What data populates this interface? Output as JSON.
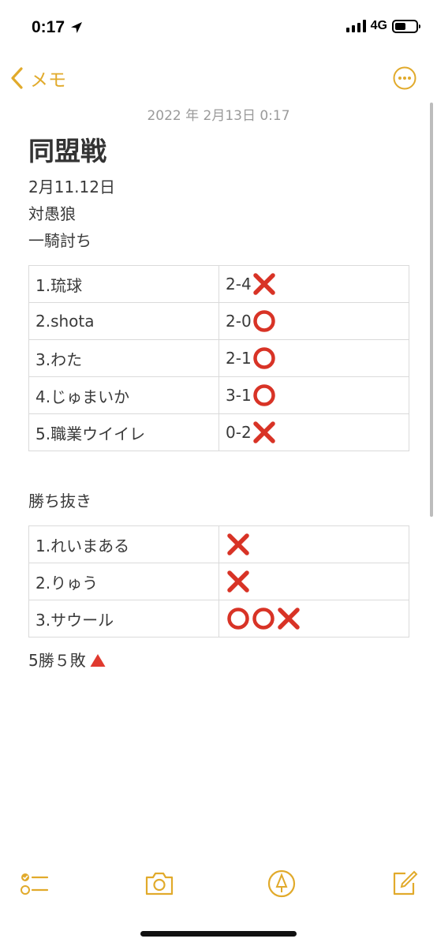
{
  "status_bar": {
    "time": "0:17",
    "network": "4G",
    "battery_level": 0.5,
    "icons": [
      "location-arrow-icon",
      "signal-icon",
      "battery-icon"
    ]
  },
  "nav": {
    "back_label": "メモ",
    "more_icon": "ellipsis-circle-icon",
    "accent_color": "#e1aa2b"
  },
  "note": {
    "date": "2022 年 2月13日 0:17",
    "title": "同盟戦",
    "lines": [
      "2月11.12日",
      "対愚狼",
      "一騎討ち"
    ],
    "table1": [
      {
        "player": "1.琉球",
        "score": "2-4",
        "marks": [
          "cross"
        ]
      },
      {
        "player": "2.shota",
        "score": "2-0",
        "marks": [
          "circle"
        ]
      },
      {
        "player": "3.わた",
        "score": "2-1",
        "marks": [
          "circle"
        ]
      },
      {
        "player": "4.じゅまいか",
        "score": "3-1",
        "marks": [
          "circle"
        ]
      },
      {
        "player": "5.職業ウイイレ",
        "score": "0-2",
        "marks": [
          "cross"
        ]
      }
    ],
    "section2_heading": "勝ち抜き",
    "table2": [
      {
        "player": "1.れいまある",
        "score": "",
        "marks": [
          "cross"
        ]
      },
      {
        "player": "2.りゅう",
        "score": "",
        "marks": [
          "cross"
        ]
      },
      {
        "player": "3.サウール",
        "score": "",
        "marks": [
          "circle",
          "circle",
          "cross"
        ]
      }
    ],
    "summary": "5勝５敗",
    "summary_mark": "triangle"
  },
  "toolbar": {
    "icons": [
      "checklist-icon",
      "camera-icon",
      "markup-icon",
      "compose-icon"
    ]
  }
}
